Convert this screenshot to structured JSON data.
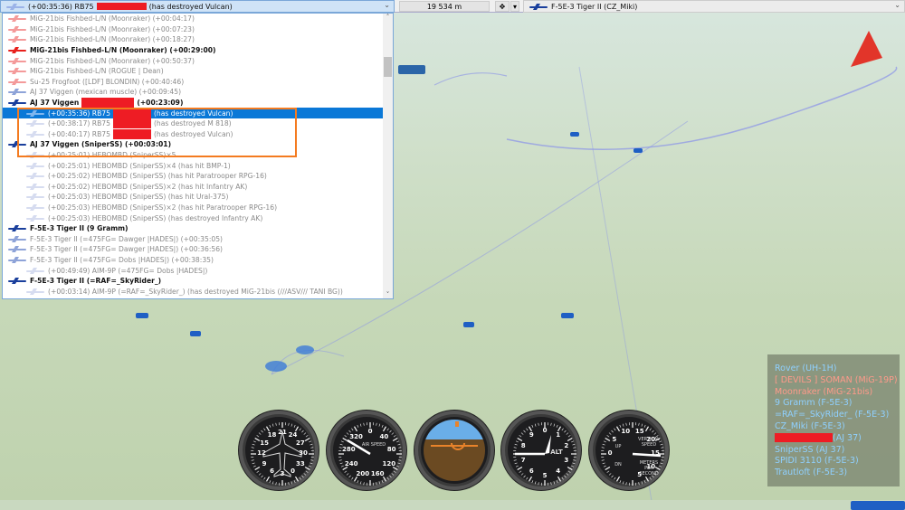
{
  "top": {
    "selected_event": "(+00:35:36) RB75",
    "selected_event_suffix": "(has destroyed Vulcan)",
    "distance": "19 534 m",
    "view_object": "F-5E-3 Tiger II (CZ_Miki)"
  },
  "colors": {
    "red_coalition": "#ee2222",
    "blue_coalition": "#1a3f9c",
    "selection": "#0a78d7",
    "highlight": "#f47b20",
    "blue_player": "#8fd0ff",
    "red_player": "#ff9a8a"
  },
  "list": [
    {
      "text": "MiG-21bis Fishbed-L/N (Moonraker) (+00:04:17)",
      "type": "red"
    },
    {
      "text": "MiG-21bis Fishbed-L/N (Moonraker) (+00:07:23)",
      "type": "red"
    },
    {
      "text": "MiG-21bis Fishbed-L/N (Moonraker) (+00:18:27)",
      "type": "red"
    },
    {
      "text": "MiG-21bis Fishbed-L/N (Moonraker) (+00:29:00)",
      "type": "red",
      "bold": true
    },
    {
      "text": "MiG-21bis Fishbed-L/N (Moonraker) (+00:50:37)",
      "type": "red"
    },
    {
      "text": "MiG-21bis Fishbed-L/N (ROGUE | Dean)",
      "type": "red"
    },
    {
      "text": "Su-25 Frogfoot ([LDF] BLONDIN) (+00:40:46)",
      "type": "red"
    },
    {
      "text": "AJ 37 Viggen (mexican muscle) (+00:09:45)",
      "type": "blue"
    },
    {
      "text": "AJ 37 Viggen",
      "suffix": "(+00:23:09)",
      "type": "blue",
      "bold": true,
      "redact": 58
    },
    {
      "text": "(+00:35:36) RB75",
      "suffix": "(has destroyed Vulcan)",
      "type": "child",
      "sel": true,
      "redact": 42
    },
    {
      "text": "(+00:38:17) RB75",
      "suffix": "(has destroyed M 818)",
      "type": "child",
      "redact": 42
    },
    {
      "text": "(+00:40:17) RB75",
      "suffix": "(has destroyed Vulcan)",
      "type": "child",
      "redact": 42
    },
    {
      "text": "AJ 37 Viggen (SniperSS) (+00:03:01)",
      "type": "blue",
      "bold": true
    },
    {
      "text": "(+00:25:01) HEBOMBD (SniperSS)×5",
      "type": "child"
    },
    {
      "text": "(+00:25:01) HEBOMBD (SniperSS)×4 (has hit BMP-1)",
      "type": "child"
    },
    {
      "text": "(+00:25:02) HEBOMBD (SniperSS) (has hit Paratrooper RPG-16)",
      "type": "child"
    },
    {
      "text": "(+00:25:02) HEBOMBD (SniperSS)×2 (has hit Infantry AK)",
      "type": "child"
    },
    {
      "text": "(+00:25:03) HEBOMBD (SniperSS) (has hit Ural-375)",
      "type": "child"
    },
    {
      "text": "(+00:25:03) HEBOMBD (SniperSS)×2 (has hit Paratrooper RPG-16)",
      "type": "child"
    },
    {
      "text": "(+00:25:03) HEBOMBD (SniperSS) (has destroyed Infantry AK)",
      "type": "child"
    },
    {
      "text": "F-5E-3 Tiger II (9 Gramm)",
      "type": "blue",
      "bold": true
    },
    {
      "text": "F-5E-3 Tiger II (=475FG= Dawger |HADES|) (+00:35:05)",
      "type": "blue"
    },
    {
      "text": "F-5E-3 Tiger II (=475FG= Dawger |HADES|) (+00:36:56)",
      "type": "blue"
    },
    {
      "text": "F-5E-3 Tiger II (=475FG= Dobs |HADES|) (+00:38:35)",
      "type": "blue"
    },
    {
      "text": "(+00:49:49) AIM-9P (=475FG= Dobs |HADES|)",
      "type": "child"
    },
    {
      "text": "F-5E-3 Tiger II (=RAF=_SkyRider_)",
      "type": "blue",
      "bold": true
    },
    {
      "text": "(+00:03:14) AIM-9P (=RAF=_SkyRider_) (has destroyed MiG-21bis (///ASV/// TANI BG))",
      "type": "child"
    }
  ],
  "players": [
    {
      "text": "Rover (UH-1H)",
      "side": "blue"
    },
    {
      "text": "[ DEVILS ] SOMAN (MiG-19P)",
      "side": "red"
    },
    {
      "text": "Moonraker (MiG-21bis)",
      "side": "red"
    },
    {
      "text": "9 Gramm (F-5E-3)",
      "side": "blue"
    },
    {
      "text": "=RAF=_SkyRider_ (F-5E-3)",
      "side": "blue"
    },
    {
      "text": "CZ_Miki (F-5E-3)",
      "side": "blue"
    },
    {
      "text": "(AJ 37)",
      "side": "blue",
      "redact": true
    },
    {
      "text": "SniperSS (AJ 37)",
      "side": "blue"
    },
    {
      "text": "SPIDI 3110 (F-5E-3)",
      "side": "blue"
    },
    {
      "text": "Trautloft (F-5E-3)",
      "side": "blue"
    }
  ],
  "gauges": {
    "heading": {
      "name": "heading-indicator",
      "ticks": [
        "21",
        "24",
        "27",
        "30",
        "33",
        "0",
        "3",
        "6",
        "9",
        "12",
        "15",
        "18"
      ]
    },
    "airspeed": {
      "label": "AIR SPEED",
      "ticks": [
        "0",
        "40",
        "80",
        "120",
        "160",
        "200",
        "240",
        "280",
        "320"
      ]
    },
    "altimeter": {
      "label": "ALT",
      "ticks": [
        "0",
        "1",
        "2",
        "3",
        "4",
        "5",
        "6",
        "7",
        "8",
        "9"
      ]
    },
    "vsi": {
      "label1": "VERTICAL SPEED",
      "label2": "METERS PER SECOND",
      "up": "UP",
      "dn": "DN",
      "ticks": [
        "0",
        "5",
        "10",
        "15",
        "20",
        "15",
        "10",
        "5"
      ]
    }
  }
}
